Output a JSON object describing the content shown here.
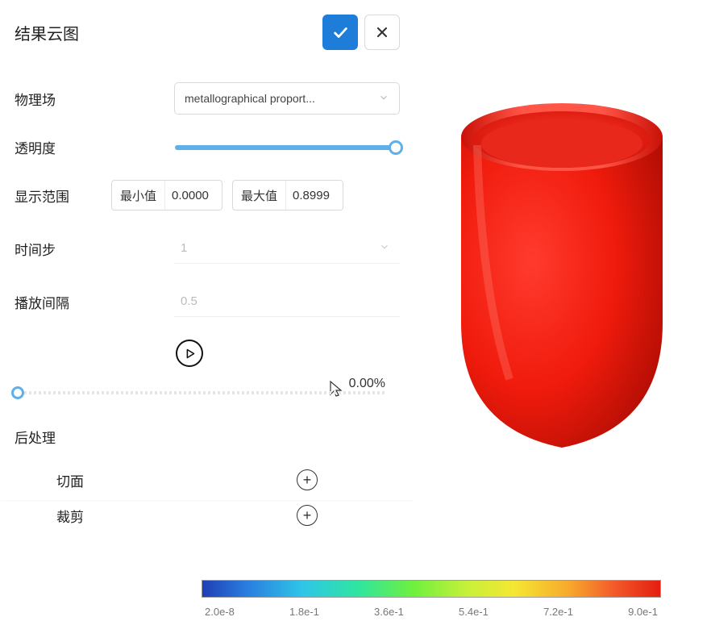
{
  "panel": {
    "title": "结果云图",
    "physics_field_label": "物理场",
    "physics_field_value": "metallographical proport...",
    "opacity_label": "透明度",
    "range_label": "显示范围",
    "range_min_label": "最小值",
    "range_min_value": "0.0000",
    "range_max_label": "最大值",
    "range_max_value": "0.8999",
    "timestep_label": "时间步",
    "timestep_value": "1",
    "interval_label": "播放间隔",
    "interval_value": "0.5",
    "progress_pct": "0.00%",
    "postprocess_label": "后处理",
    "section_cut_label": "切面",
    "crop_label": "裁剪"
  },
  "legend": {
    "ticks": [
      "2.0e-8",
      "1.8e-1",
      "3.6e-1",
      "5.4e-1",
      "7.2e-1",
      "9.0e-1"
    ]
  }
}
